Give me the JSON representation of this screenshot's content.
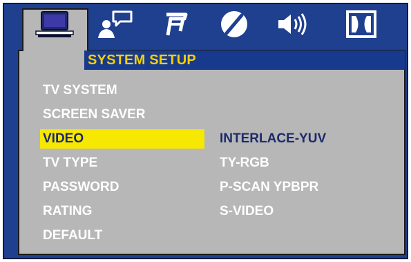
{
  "colors": {
    "screen_bg": "#1f3f8f",
    "panel_bg": "#b7b7b7",
    "title_text": "#f6d000",
    "highlight": "#f6e800",
    "selected_text": "#1c2a6a"
  },
  "tabs": [
    {
      "icon": "monitor-icon",
      "active": true
    },
    {
      "icon": "user-chat-icon",
      "active": false
    },
    {
      "icon": "music-note-icon",
      "active": false
    },
    {
      "icon": "disc-icon",
      "active": false
    },
    {
      "icon": "speaker-icon",
      "active": false
    },
    {
      "icon": "dolby-icon",
      "active": false
    }
  ],
  "title": "SYSTEM SETUP",
  "menu": {
    "items": [
      {
        "label": "TV SYSTEM"
      },
      {
        "label": "SCREEN SAVER"
      },
      {
        "label": "VIDEO",
        "selected": true
      },
      {
        "label": "TV TYPE"
      },
      {
        "label": "PASSWORD"
      },
      {
        "label": "RATING"
      },
      {
        "label": "DEFAULT"
      }
    ]
  },
  "options": {
    "items": [
      {
        "label": "INTERLACE-YUV",
        "current": true
      },
      {
        "label": "TY-RGB"
      },
      {
        "label": "P-SCAN YPBPR"
      },
      {
        "label": "S-VIDEO"
      }
    ]
  }
}
